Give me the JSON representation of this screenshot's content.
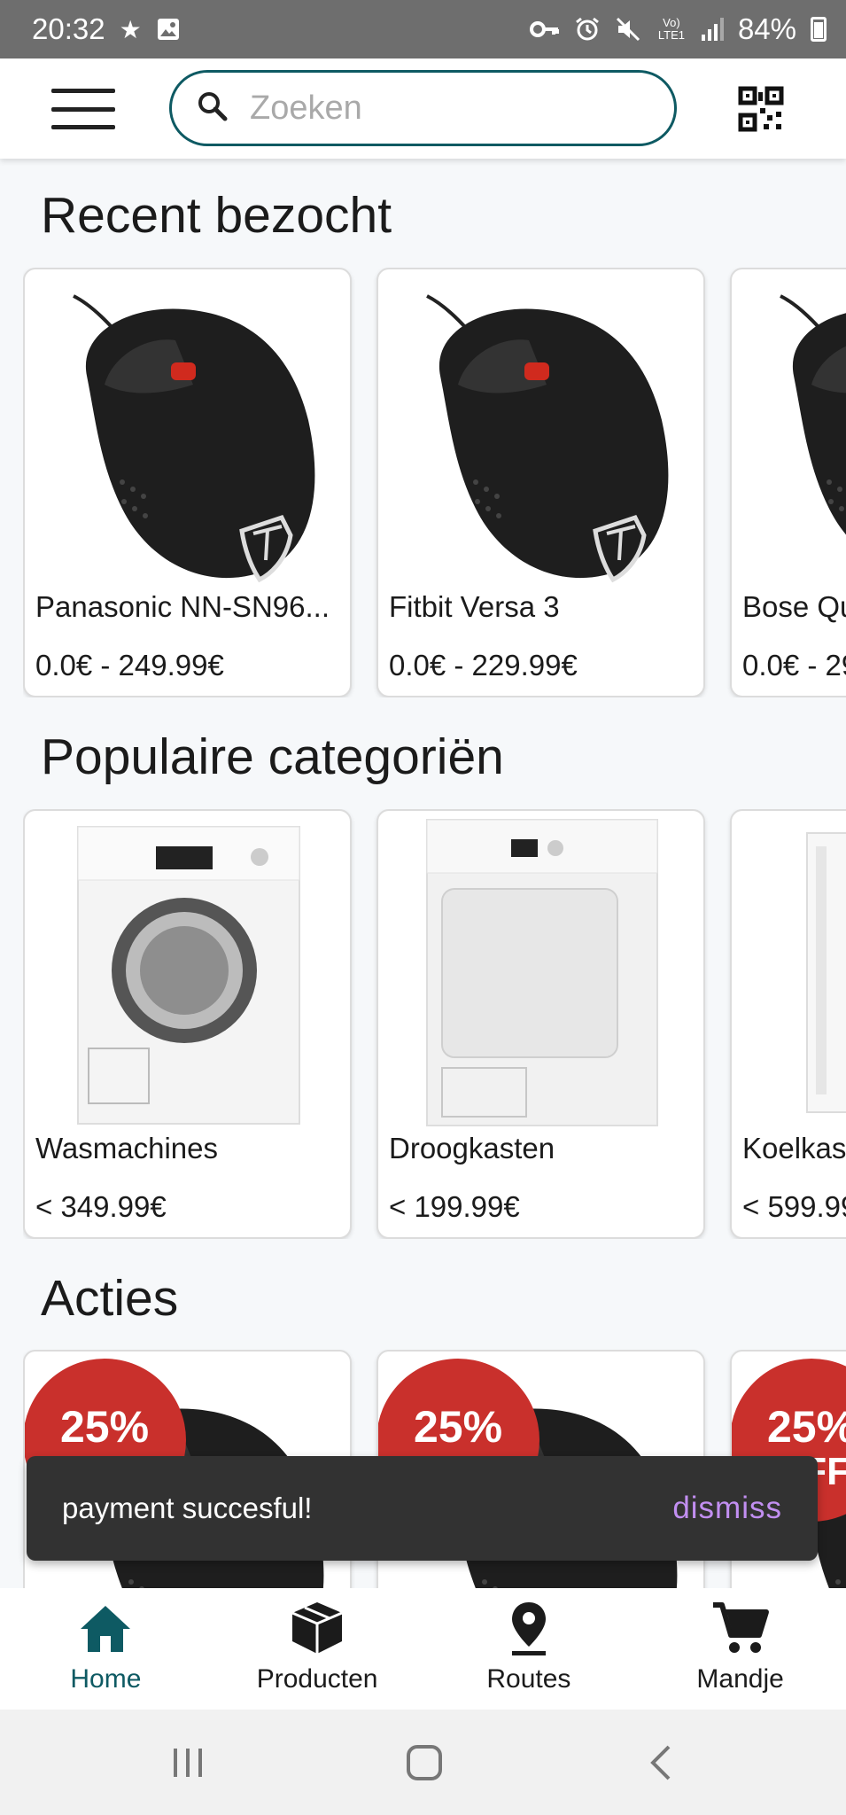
{
  "status_bar": {
    "time": "20:32",
    "battery": "84%",
    "volte_label": "Vo) LTE1"
  },
  "search": {
    "placeholder": "Zoeken"
  },
  "sections": {
    "recent": {
      "title": "Recent bezocht",
      "items": [
        {
          "name": "Panasonic NN-SN96...",
          "price": "0.0€ - 249.99€"
        },
        {
          "name": "Fitbit Versa 3",
          "price": "0.0€ - 229.99€"
        },
        {
          "name": "Bose Qu",
          "price": "0.0€ - 29"
        }
      ]
    },
    "categories": {
      "title": "Populaire categoriën",
      "items": [
        {
          "name": "Wasmachines",
          "price": "< 349.99€"
        },
        {
          "name": "Droogkasten",
          "price": "< 199.99€"
        },
        {
          "name": "Koelkas",
          "price": "< 599.99"
        }
      ]
    },
    "deals": {
      "title": "Acties",
      "badge": "25%",
      "badge_sub": "OFF"
    }
  },
  "snackbar": {
    "message": "payment succesful!",
    "action": "dismiss"
  },
  "bottom_nav": [
    {
      "label": "Home",
      "icon": "home-icon",
      "active": true
    },
    {
      "label": "Producten",
      "icon": "package-icon",
      "active": false
    },
    {
      "label": "Routes",
      "icon": "location-pin-icon",
      "active": false
    },
    {
      "label": "Mandje",
      "icon": "cart-icon",
      "active": false
    }
  ],
  "colors": {
    "accent": "#0e5a63",
    "snackbar_action": "#c28ff1",
    "sale_badge": "#c9302c"
  }
}
